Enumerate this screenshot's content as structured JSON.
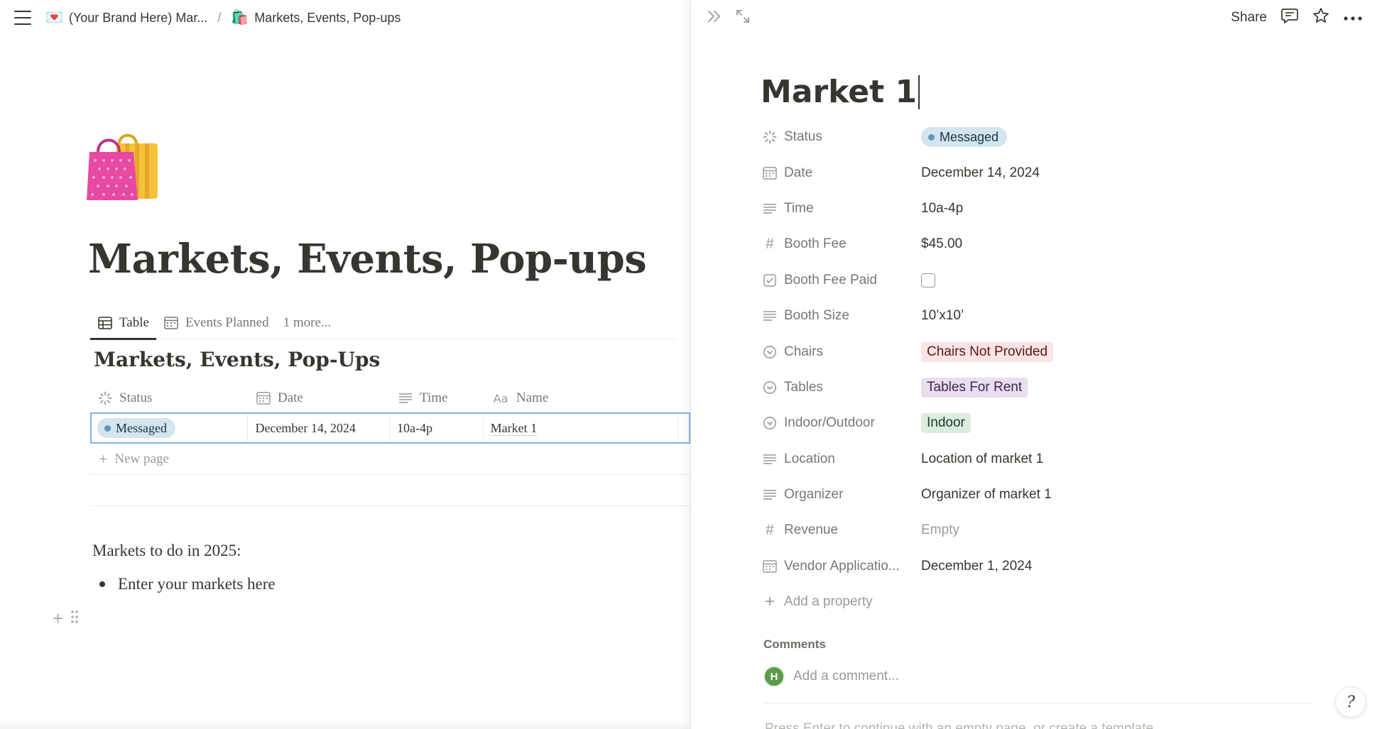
{
  "breadcrumb": {
    "parent_emoji": "💌",
    "parent_label": "(Your Brand Here) Mar...",
    "separator": "/",
    "current_emoji": "🛍️",
    "current_label": "Markets, Events, Pop-ups"
  },
  "page": {
    "title": "Markets, Events, Pop-ups",
    "views": [
      {
        "label": "Table"
      },
      {
        "label": "Events Planned"
      },
      {
        "label": "1 more..."
      }
    ],
    "database_title": "Markets, Events, Pop-Ups",
    "columns": [
      "Status",
      "Date",
      "Time",
      "Name"
    ],
    "rows": [
      {
        "status": "Messaged",
        "date": "December 14, 2024",
        "time": "10a-4p",
        "name": "Market 1"
      }
    ],
    "new_page_label": "New page",
    "note": "Markets to do in 2025:",
    "bullet": "Enter your markets here"
  },
  "peek": {
    "share_label": "Share",
    "title": "Market 1",
    "properties": [
      {
        "label": "Status",
        "value": "Messaged"
      },
      {
        "label": "Date",
        "value": "December 14, 2024"
      },
      {
        "label": "Time",
        "value": "10a-4p"
      },
      {
        "label": "Booth Fee",
        "value": "$45.00"
      },
      {
        "label": "Booth Fee Paid",
        "value": ""
      },
      {
        "label": "Booth Size",
        "value": "10’x10’"
      },
      {
        "label": "Chairs",
        "value": "Chairs Not Provided"
      },
      {
        "label": "Tables",
        "value": "Tables For Rent"
      },
      {
        "label": "Indoor/Outdoor",
        "value": "Indoor"
      },
      {
        "label": "Location",
        "value": "Location of market 1"
      },
      {
        "label": "Organizer",
        "value": "Organizer of market 1"
      },
      {
        "label": "Revenue",
        "value": "Empty"
      },
      {
        "label": "Vendor Applicatio...",
        "value": "December 1, 2024"
      }
    ],
    "add_property_label": "Add a property",
    "comments_label": "Comments",
    "avatar_initial": "H",
    "comment_placeholder": "Add a comment...",
    "hint": "Press Enter to continue with an empty page, or create a template"
  },
  "colors": {
    "accent_blue": "#7fb4e6",
    "text": "#37352f",
    "muted": "#787774"
  }
}
